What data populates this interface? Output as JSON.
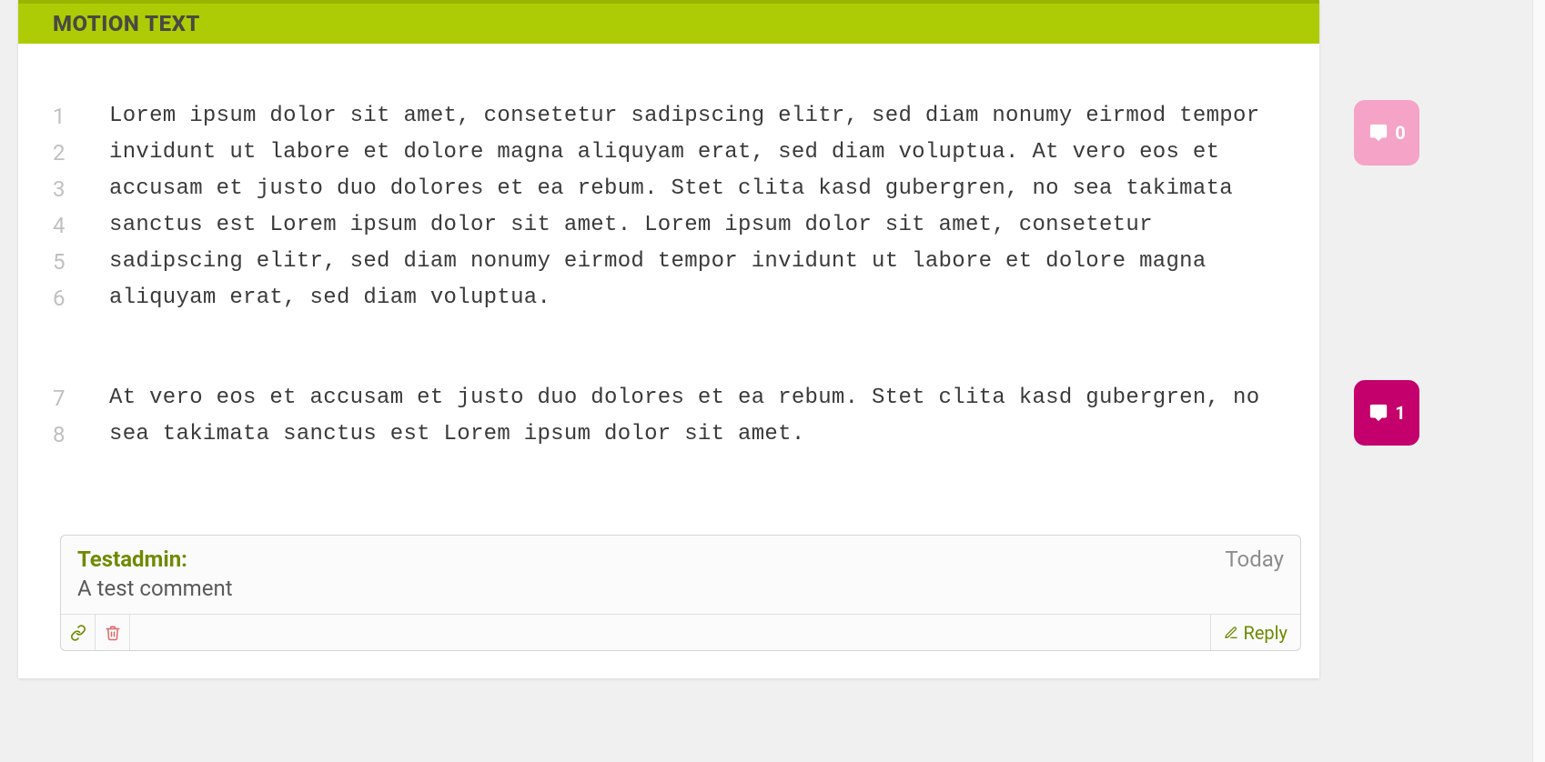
{
  "header": {
    "title": "MOTION TEXT"
  },
  "paragraphs": [
    {
      "line_start": 1,
      "line_end": 6,
      "text": "Lorem ipsum dolor sit amet, consetetur sadipscing elitr, sed diam nonumy eirmod tempor invidunt ut labore et dolore magna aliquyam erat, sed diam voluptua. At vero eos et accusam et justo duo dolores et ea rebum. Stet clita kasd gubergren, no sea takimata sanctus est Lorem ipsum dolor sit amet. Lorem ipsum dolor sit amet, consetetur sadipscing elitr, sed diam nonumy eirmod tempor invidunt ut labore et dolore magna aliquyam erat, sed diam voluptua."
    },
    {
      "line_start": 7,
      "line_end": 8,
      "text": "At vero eos et accusam et justo duo dolores et ea rebum. Stet clita kasd gubergren, no sea takimata sanctus est Lorem ipsum dolor sit amet."
    }
  ],
  "comment": {
    "author_label": "Testadmin:",
    "date_label": "Today",
    "body": "A test comment",
    "reply_label": "Reply"
  },
  "side_badges": [
    {
      "count": "0",
      "color": "pink"
    },
    {
      "count": "1",
      "color": "magenta"
    }
  ]
}
